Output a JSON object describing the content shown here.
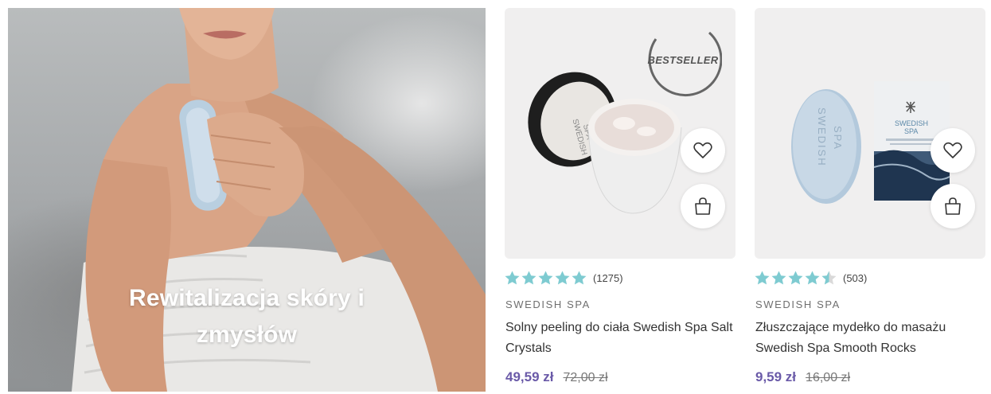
{
  "hero": {
    "title": "Rewitalizacja skóry i zmysłów"
  },
  "products": [
    {
      "badge": "BESTSELLER",
      "rating": 5,
      "review_count": "(1275)",
      "brand": "SWEDISH SPA",
      "name": "Solny peeling do ciała Swedish Spa Salt Crystals",
      "price": "49,59 zł",
      "old_price": "72,00 zł",
      "package_text_1": "SWEDISH",
      "package_text_2": "SPA",
      "wishlist_icon": "heart-icon",
      "cart_icon": "shopping-bag-icon"
    },
    {
      "rating": 4.5,
      "review_count": "(503)",
      "brand": "SWEDISH SPA",
      "name": "Złuszczające mydełko do masażu Swedish Spa Smooth Rocks",
      "price": "9,59 zł",
      "old_price": "16,00 zł",
      "package_text_1": "SWEDISH",
      "package_text_2": "SPA",
      "soap_text_1": "SWEDISH",
      "soap_text_2": "SPA",
      "wishlist_icon": "heart-icon",
      "cart_icon": "shopping-bag-icon"
    }
  ],
  "colors": {
    "star": "#7ecbd1",
    "star_empty": "#d9d9d9",
    "price": "#6a5aa8",
    "card_bg": "#f0efef"
  }
}
